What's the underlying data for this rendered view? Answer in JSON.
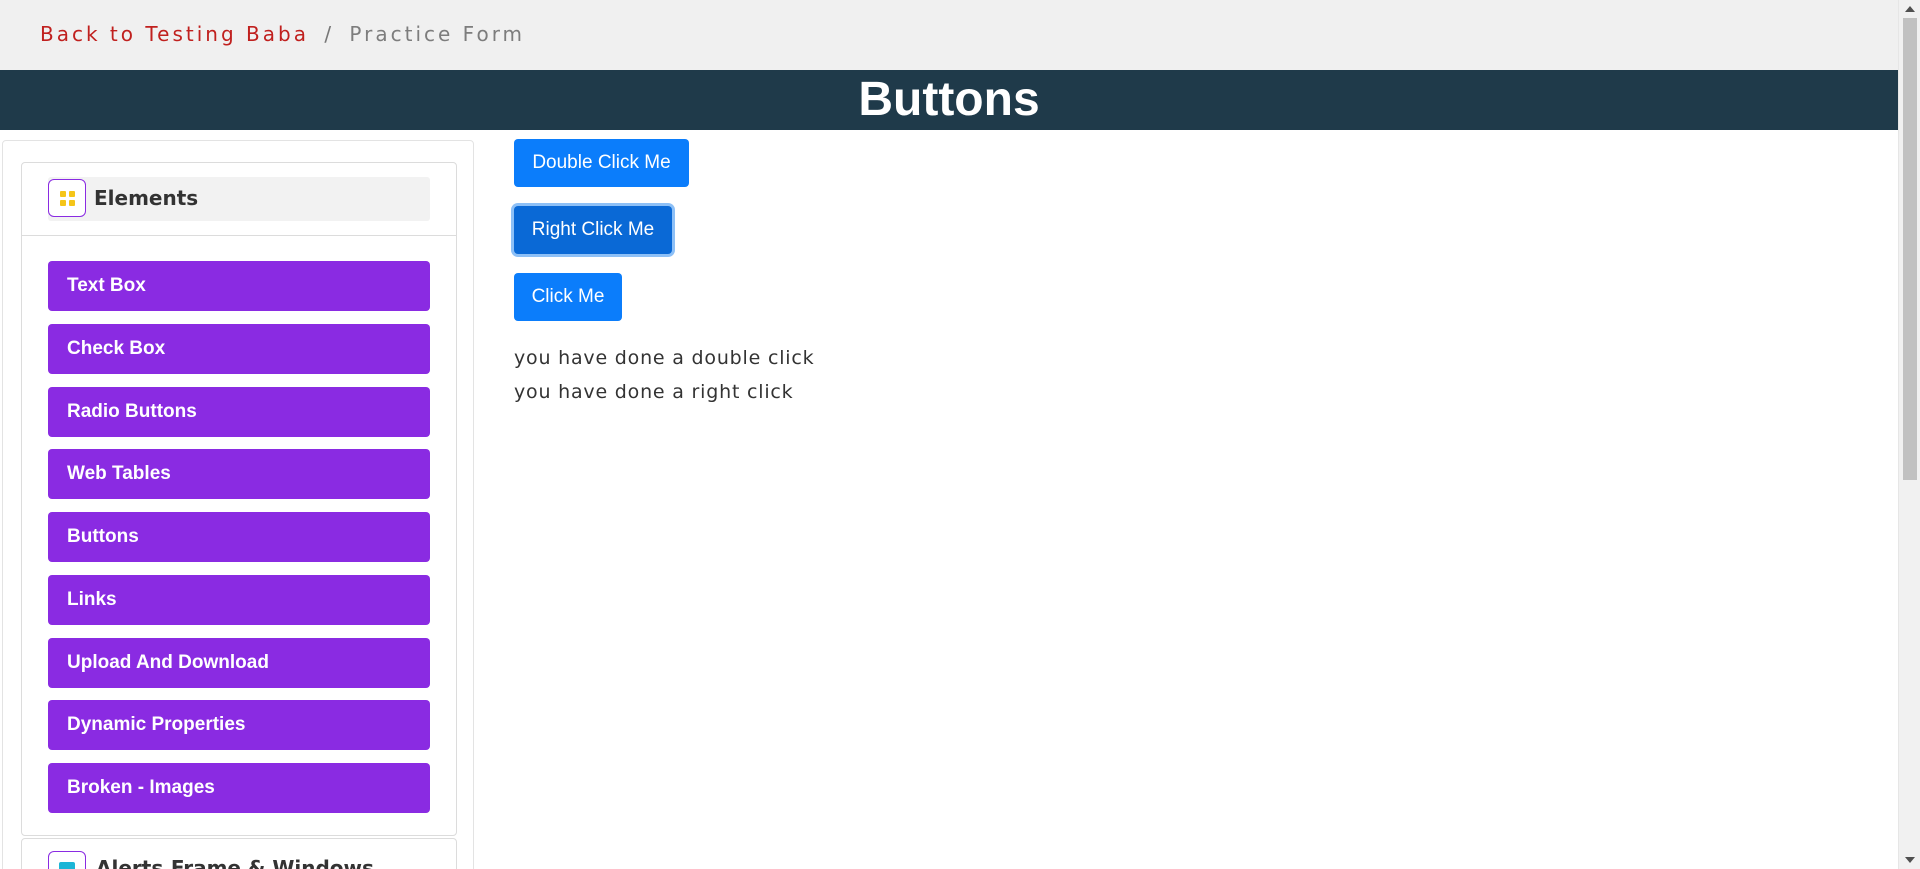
{
  "breadcrumb": {
    "back_link": "Back to Testing Baba",
    "separator": "/",
    "current": "Practice Form"
  },
  "header": {
    "title": "Buttons"
  },
  "sidebar": {
    "groups": [
      {
        "title": "Elements",
        "icon": "grid-icon",
        "items": [
          {
            "label": "Text Box"
          },
          {
            "label": "Check Box"
          },
          {
            "label": "Radio Buttons"
          },
          {
            "label": "Web Tables"
          },
          {
            "label": "Buttons"
          },
          {
            "label": "Links"
          },
          {
            "label": "Upload And Download"
          },
          {
            "label": "Dynamic Properties"
          },
          {
            "label": "Broken - Images"
          }
        ]
      },
      {
        "title": "Alerts,Frame & Windows",
        "icon": "window-icon"
      }
    ]
  },
  "main": {
    "buttons": {
      "double_click": "Double Click Me",
      "right_click": "Right Click Me",
      "click": "Click Me"
    },
    "messages": {
      "double_click_msg": "you have done a double click",
      "right_click_msg": "you have done a right click"
    }
  },
  "colors": {
    "accent_purple": "#8a2be2",
    "button_blue": "#0b7dfb",
    "header_band": "#1f3a4a",
    "breadcrumb_link": "#c0201e"
  }
}
